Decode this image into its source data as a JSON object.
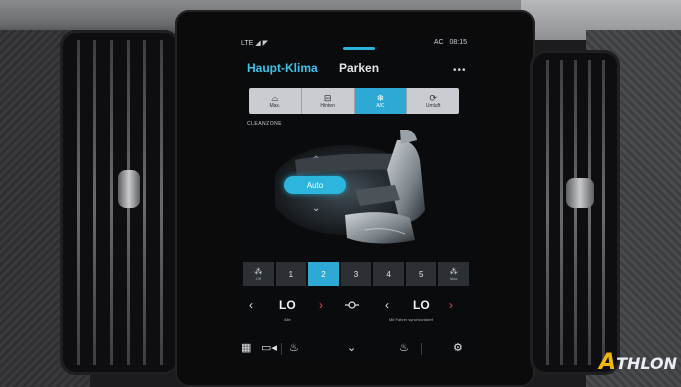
{
  "status": {
    "left": "LTE ◢ ◤",
    "ac_indicator": "AC",
    "time": "08:15"
  },
  "header": {
    "active_tab": "Haupt-Klima",
    "tab2": "Parken",
    "more": "•••"
  },
  "defrost": [
    {
      "icon": "⌓",
      "label": "Max."
    },
    {
      "icon": "⊟",
      "label": "Hinten"
    },
    {
      "icon": "❄",
      "label": "A/C",
      "active": true
    },
    {
      "icon": "⟳",
      "label": "Umluft"
    }
  ],
  "clean_zone": "CLEANZONE",
  "auto_label": "Auto",
  "fan": [
    {
      "icon": "⁂",
      "label": "Off"
    },
    {
      "label": "1"
    },
    {
      "label": "2",
      "active": true
    },
    {
      "label": "3"
    },
    {
      "label": "4"
    },
    {
      "label": "5"
    },
    {
      "icon": "⁂",
      "label": "Max"
    }
  ],
  "temp": {
    "left_value": "LO",
    "left_sub": "Alle",
    "right_value": "LO",
    "right_sub": "Mit Fahrer synchronisiert"
  },
  "colors": {
    "accent": "#2ea9d6",
    "arrow_red": "#e0464a",
    "screen_bg": "#0a0b0d"
  },
  "brand": {
    "initial": "A",
    "rest": "THLON"
  }
}
